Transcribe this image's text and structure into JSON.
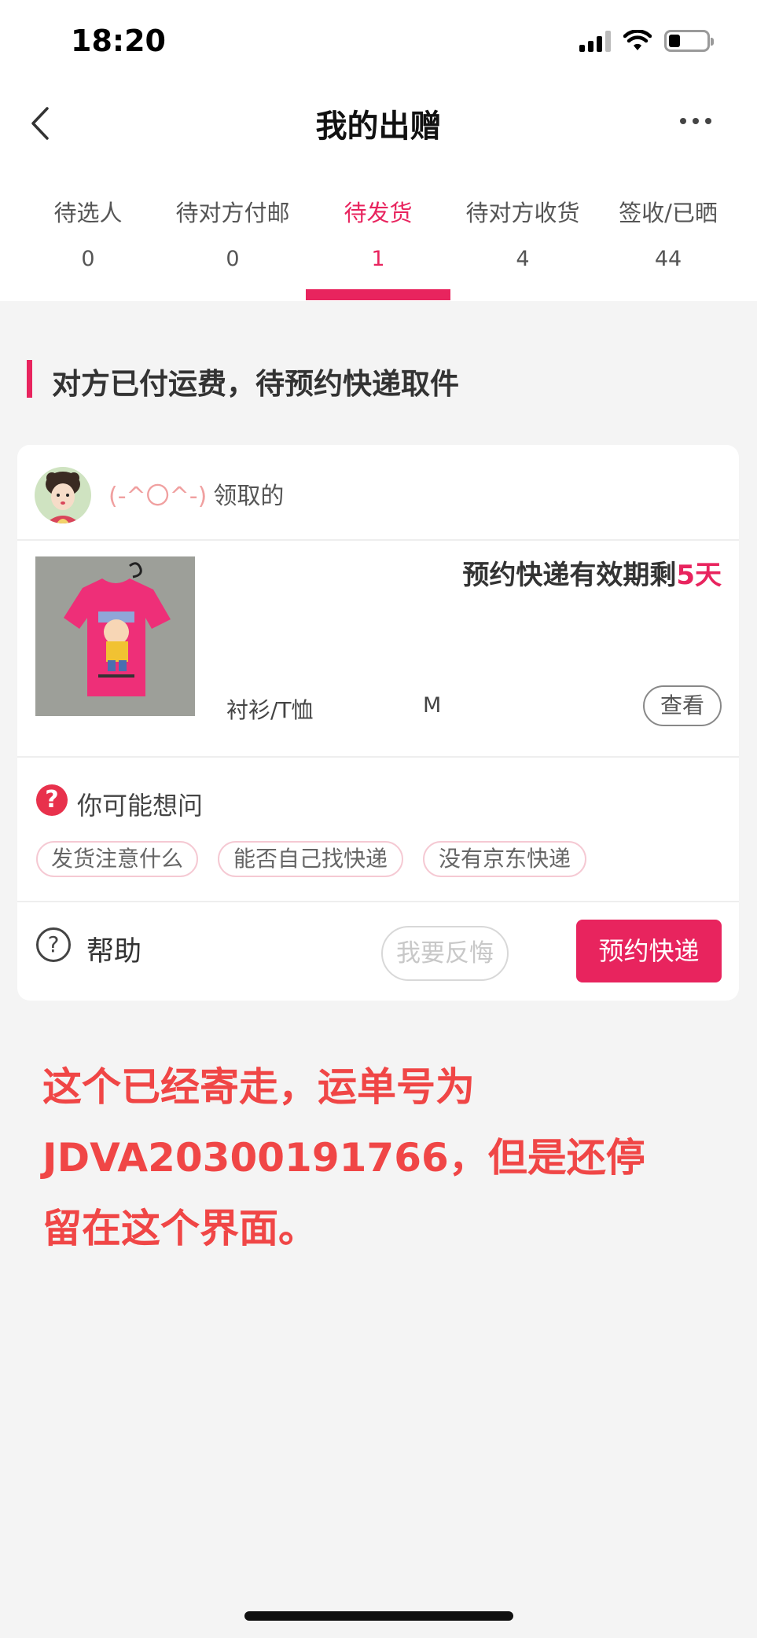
{
  "status_bar": {
    "time": "18:20"
  },
  "nav": {
    "title": "我的出赠"
  },
  "tabs": [
    {
      "label": "待选人",
      "count": "0"
    },
    {
      "label": "待对方付邮",
      "count": "0"
    },
    {
      "label": "待发货",
      "count": "1"
    },
    {
      "label": "待对方收货",
      "count": "4"
    },
    {
      "label": "签收/已晒",
      "count": "44"
    }
  ],
  "active_tab": "待发货",
  "section": {
    "title": "对方已付运费，待预约快递取件"
  },
  "order": {
    "receiver_name": "(-^〇^-)",
    "receiver_suffix": "领取的",
    "deadline_prefix": "预约快递有效期剩",
    "deadline_days": "5天",
    "category": "衬衫/T恤",
    "size": "M",
    "view_label": "查看"
  },
  "faq": {
    "title": "你可能想问",
    "chips": [
      "发货注意什么",
      "能否自己找快递",
      "没有京东快递"
    ]
  },
  "actions": {
    "help_label": "帮助",
    "regret_label": "我要反悔",
    "book_label": "预约快递"
  },
  "annotation": {
    "lines": [
      "这个已经寄走，运单号为",
      "JDVA20300191766，但是还停",
      "留在这个界面。"
    ]
  },
  "colors": {
    "accent": "#e8245e",
    "annotation": "#f04646"
  }
}
